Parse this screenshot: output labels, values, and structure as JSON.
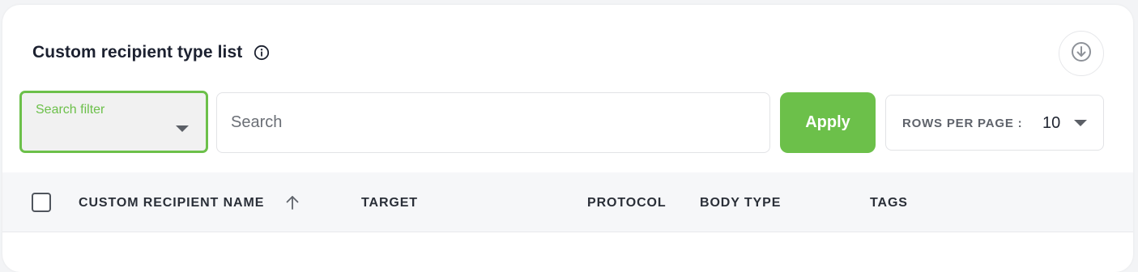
{
  "header": {
    "title": "Custom recipient type list",
    "info_icon": "info-icon",
    "download_icon": "download-icon"
  },
  "toolbar": {
    "filter_label": "Search filter",
    "search_placeholder": "Search",
    "search_value": "",
    "apply_label": "Apply",
    "rows_per_page_label": "ROWS PER PAGE :",
    "rows_per_page_value": "10"
  },
  "table": {
    "columns": [
      {
        "label": "CUSTOM RECIPIENT NAME",
        "sort": "ascending"
      },
      {
        "label": "TARGET"
      },
      {
        "label": "PROTOCOL"
      },
      {
        "label": "BODY TYPE"
      },
      {
        "label": "TAGS"
      }
    ]
  },
  "colors": {
    "accent": "#6cc04a",
    "header_bg": "#f6f7f9"
  }
}
